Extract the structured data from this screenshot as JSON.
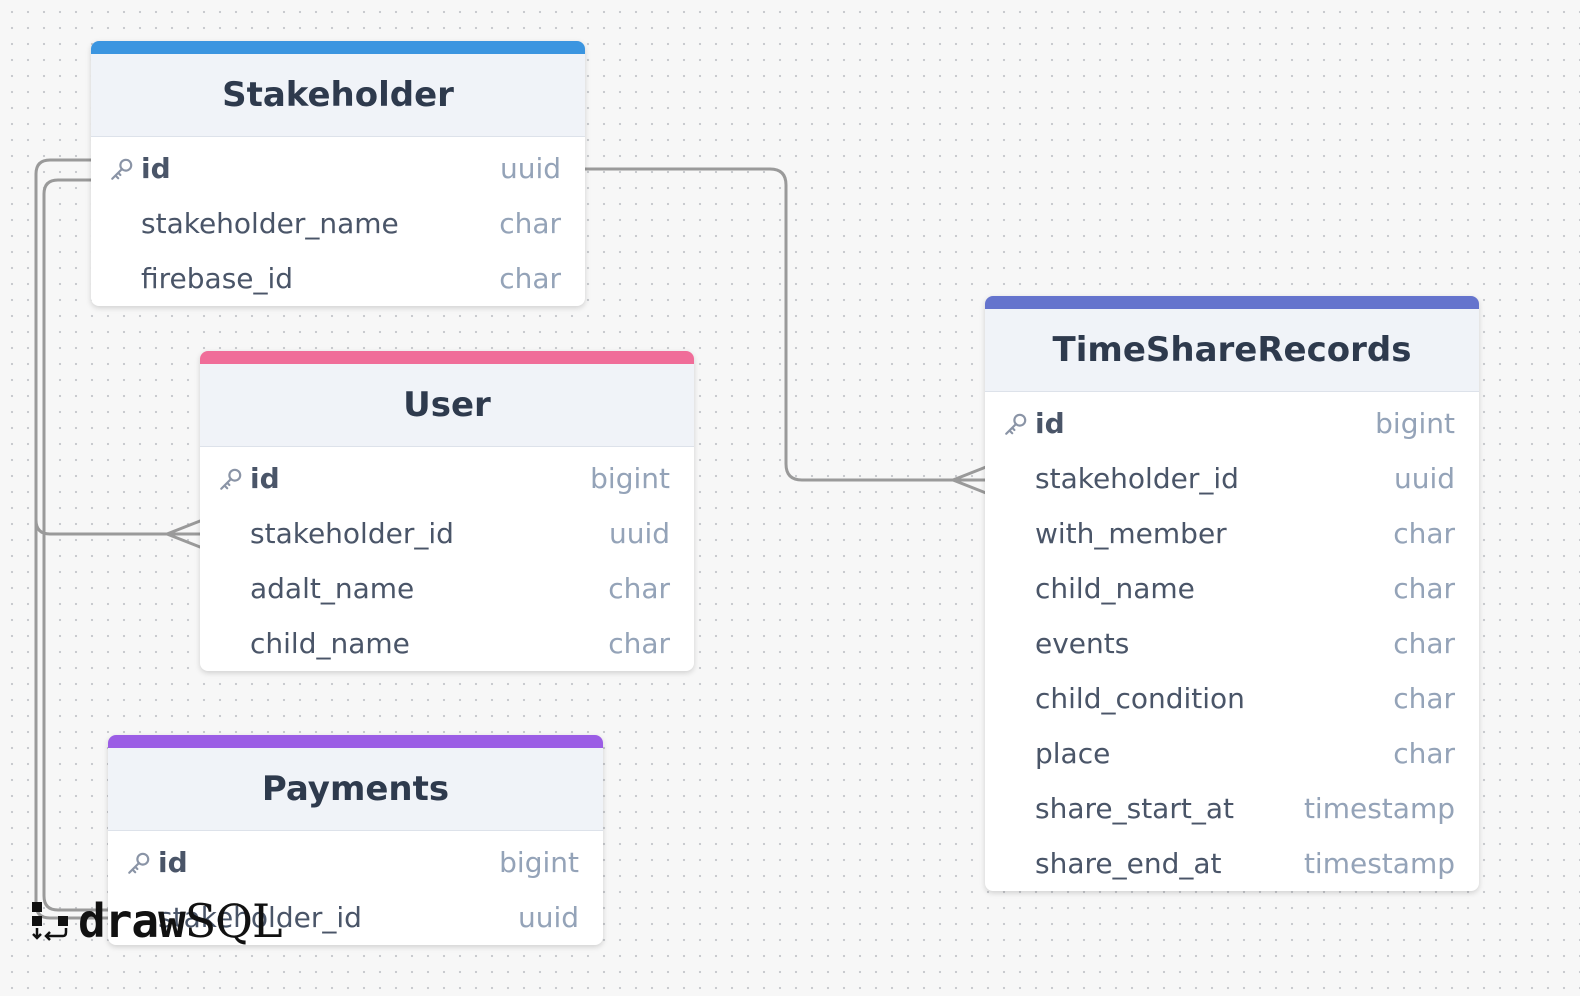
{
  "tables": [
    {
      "name": "Stakeholder",
      "color": "#3b95e0",
      "columns": [
        {
          "name": "id",
          "type": "uuid",
          "pk": true
        },
        {
          "name": "stakeholder_name",
          "type": "char"
        },
        {
          "name": "firebase_id",
          "type": "char"
        }
      ]
    },
    {
      "name": "User",
      "color": "#f06d99",
      "columns": [
        {
          "name": "id",
          "type": "bigint",
          "pk": true
        },
        {
          "name": "stakeholder_id",
          "type": "uuid"
        },
        {
          "name": "adalt_name",
          "type": "char"
        },
        {
          "name": "child_name",
          "type": "char"
        }
      ]
    },
    {
      "name": "Payments",
      "color": "#9b5de5",
      "columns": [
        {
          "name": "id",
          "type": "bigint",
          "pk": true
        },
        {
          "name": "stakeholder_id",
          "type": "uuid"
        }
      ]
    },
    {
      "name": "TimeShareRecords",
      "color": "#6574cd",
      "columns": [
        {
          "name": "id",
          "type": "bigint",
          "pk": true
        },
        {
          "name": "stakeholder_id",
          "type": "uuid"
        },
        {
          "name": "with_member",
          "type": "char"
        },
        {
          "name": "child_name",
          "type": "char"
        },
        {
          "name": "events",
          "type": "char"
        },
        {
          "name": "child_condition",
          "type": "char"
        },
        {
          "name": "place",
          "type": "char"
        },
        {
          "name": "share_start_at",
          "type": "timestamp"
        },
        {
          "name": "share_end_at",
          "type": "timestamp"
        }
      ]
    }
  ],
  "relations": [
    {
      "from": "Stakeholder.id",
      "to": "User.stakeholder_id",
      "cardinality": "one-to-many"
    },
    {
      "from": "Stakeholder.id",
      "to": "Payments.stakeholder_id",
      "cardinality": "one-to-many"
    },
    {
      "from": "Stakeholder.id",
      "to": "TimeShareRecords.stakeholder_id",
      "cardinality": "one-to-many"
    }
  ],
  "logo": {
    "bold": "draw",
    "light": "SQL"
  },
  "colors": {
    "line": "#9a9a9a",
    "title_text": "#2e3a4d",
    "column_text": "#4a5568",
    "type_text": "#94a3b8"
  }
}
